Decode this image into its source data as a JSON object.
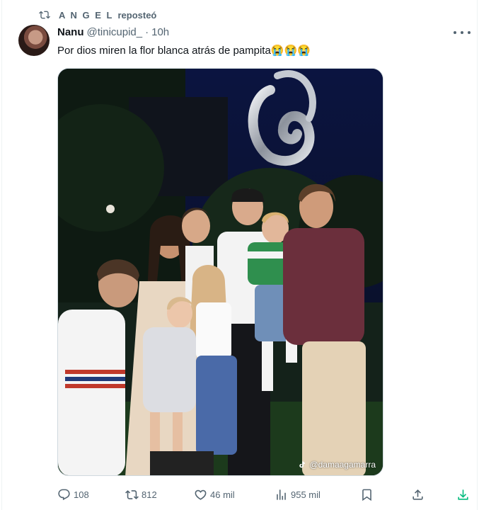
{
  "repost": {
    "user": "A N G E L",
    "label": "reposteó",
    "icon": "repost-icon"
  },
  "tweet": {
    "display_name": "Nanu",
    "handle": "@tinicupid_",
    "separator": "·",
    "time": "10h",
    "text": "Por dios miren la flor blanca atrás de pampita😭😭😭",
    "media": {
      "watermark": "@damaagamarra",
      "watermark_icon": "tiktok-icon"
    }
  },
  "actions": {
    "replies": "108",
    "reposts": "812",
    "likes": "46 mil",
    "views": "955 mil"
  },
  "colors": {
    "secondary_text": "#536471",
    "primary_text": "#0f1419",
    "download_accent": "#00ba7c",
    "border": "#cfd9de"
  }
}
